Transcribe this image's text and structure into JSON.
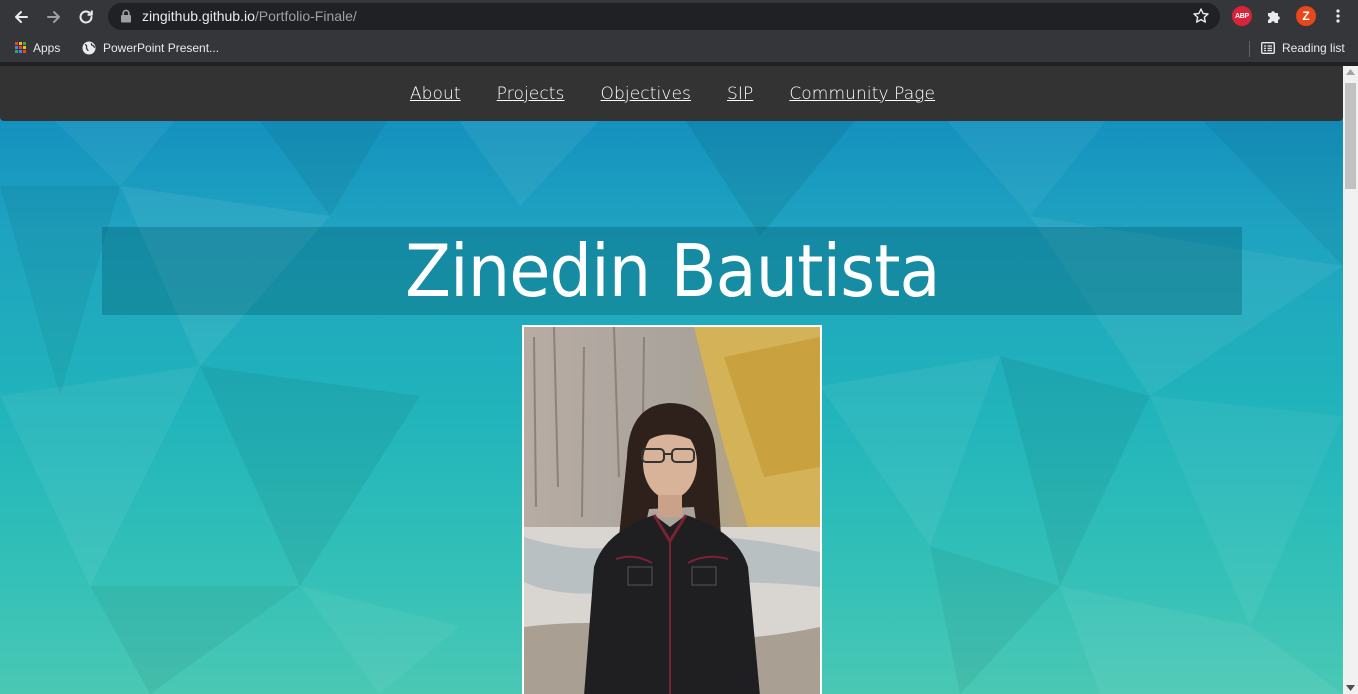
{
  "browser": {
    "url_host": "zingithub.github.io",
    "url_path": "/Portfolio-Finale/",
    "extension_abp": "ABP",
    "profile_initial": "Z",
    "bookmarks": [
      {
        "label": "Apps",
        "icon": "apps-grid-icon"
      },
      {
        "label": "PowerPoint Present...",
        "icon": "globe-icon"
      }
    ],
    "reading_list": "Reading list"
  },
  "site": {
    "nav": [
      "About",
      "Projects",
      "Objectives",
      "SIP",
      "Community Page"
    ],
    "title": "Zinedin Bautista"
  },
  "colors": {
    "chrome_bg": "#35363a",
    "nav_bg": "#333333",
    "page_gradient_top": "#0f88be",
    "page_gradient_bottom": "#4ac8b4"
  }
}
